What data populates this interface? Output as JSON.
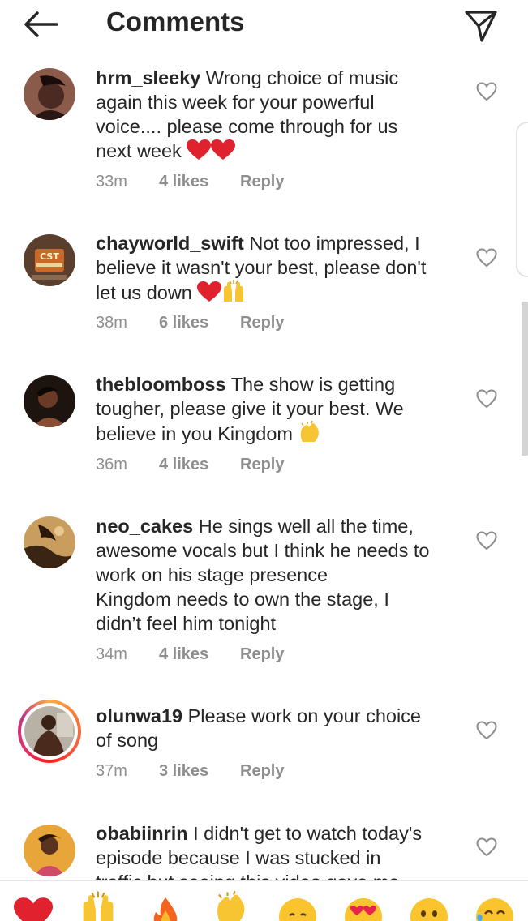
{
  "header": {
    "title": "Comments",
    "back_icon": "arrow-left-icon",
    "send_icon": "paper-plane-icon"
  },
  "comments": [
    {
      "username": "hrm_sleeky",
      "text_lines": [
        "Wrong choice of music",
        "again this week for your powerful",
        "voice.... please come through for us",
        "next week"
      ],
      "time": "33m",
      "likes": "4 likes",
      "reply": "Reply"
    },
    {
      "username": "chayworld_swift",
      "text_lines": [
        "Not too impressed, I",
        "believe it wasn't your best, please don't",
        "let us down"
      ],
      "time": "38m",
      "likes": "6 likes",
      "reply": "Reply",
      "avatar_text": "CST"
    },
    {
      "username": "thebloomboss",
      "text_lines": [
        "The show is getting",
        "tougher, please give it your best. We",
        "believe in you Kingdom"
      ],
      "time": "36m",
      "likes": "4 likes",
      "reply": "Reply"
    },
    {
      "username": "neo_cakes",
      "text_lines": [
        "He sings well all the time,",
        "awesome vocals but I think he needs to",
        "work on his stage presence",
        "Kingdom needs to own the stage, I",
        "didn’t feel him tonight"
      ],
      "time": "34m",
      "likes": "4 likes",
      "reply": "Reply"
    },
    {
      "username": "olunwa19",
      "text_lines": [
        "Please work on your choice",
        "of song"
      ],
      "time": "37m",
      "likes": "3 likes",
      "reply": "Reply"
    },
    {
      "username": "obabiinrin",
      "text_lines": [
        "I didn't get to watch today's",
        "episode because I was stucked in",
        "traffic but seeing this video gave me"
      ]
    }
  ],
  "quick_emojis": [
    "heart",
    "raised-hands",
    "fire",
    "clapping-hands",
    "crying-face",
    "heart-eyes",
    "surprised-face",
    "tears-of-joy"
  ],
  "colors": {
    "heart_red": "#e0212e",
    "meta_gray": "#8e8e8e",
    "text": "#262626"
  }
}
